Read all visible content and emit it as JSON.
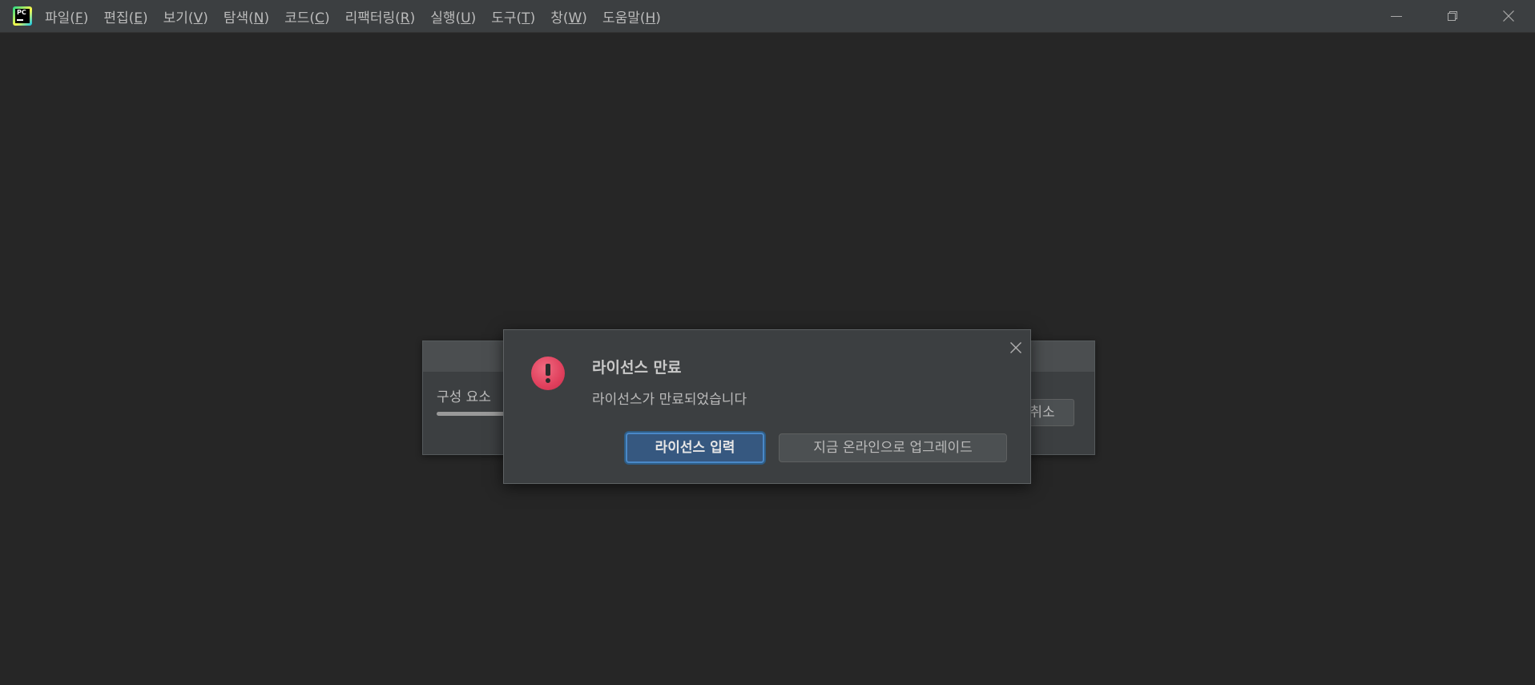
{
  "app": {
    "logo_text": "PC",
    "logo_icon": "pycharm-logo-icon"
  },
  "menu": {
    "items": [
      {
        "label": "파일(",
        "mnemonic": "F",
        "close": ")"
      },
      {
        "label": "편집(",
        "mnemonic": "E",
        "close": ")"
      },
      {
        "label": "보기(",
        "mnemonic": "V",
        "close": ")"
      },
      {
        "label": "탐색(",
        "mnemonic": "N",
        "close": ")"
      },
      {
        "label": "코드(",
        "mnemonic": "C",
        "close": ")"
      },
      {
        "label": "리팩터링(",
        "mnemonic": "R",
        "close": ")"
      },
      {
        "label": "실행(",
        "mnemonic": "U",
        "close": ")"
      },
      {
        "label": "도구(",
        "mnemonic": "T",
        "close": ")"
      },
      {
        "label": "창(",
        "mnemonic": "W",
        "close": ")"
      },
      {
        "label": "도움말(",
        "mnemonic": "H",
        "close": ")"
      }
    ]
  },
  "window_controls": {
    "minimize_icon": "minimize-icon",
    "restore_icon": "restore-icon",
    "close_icon": "close-icon"
  },
  "background_dialog": {
    "label": "구성 요소",
    "cancel_label": "취소",
    "progress": 0.25
  },
  "license_dialog": {
    "title": "라이선스 만료",
    "message": "라이선스가 만료되었습니다",
    "primary_button": "라이선스 입력",
    "secondary_button": "지금 온라인으로 업그레이드",
    "icon": "error-icon",
    "close_icon": "close-icon"
  },
  "colors": {
    "background": "#262626",
    "panel": "#3c3f41",
    "primary_button": "#365880",
    "error": "#e0405d"
  }
}
